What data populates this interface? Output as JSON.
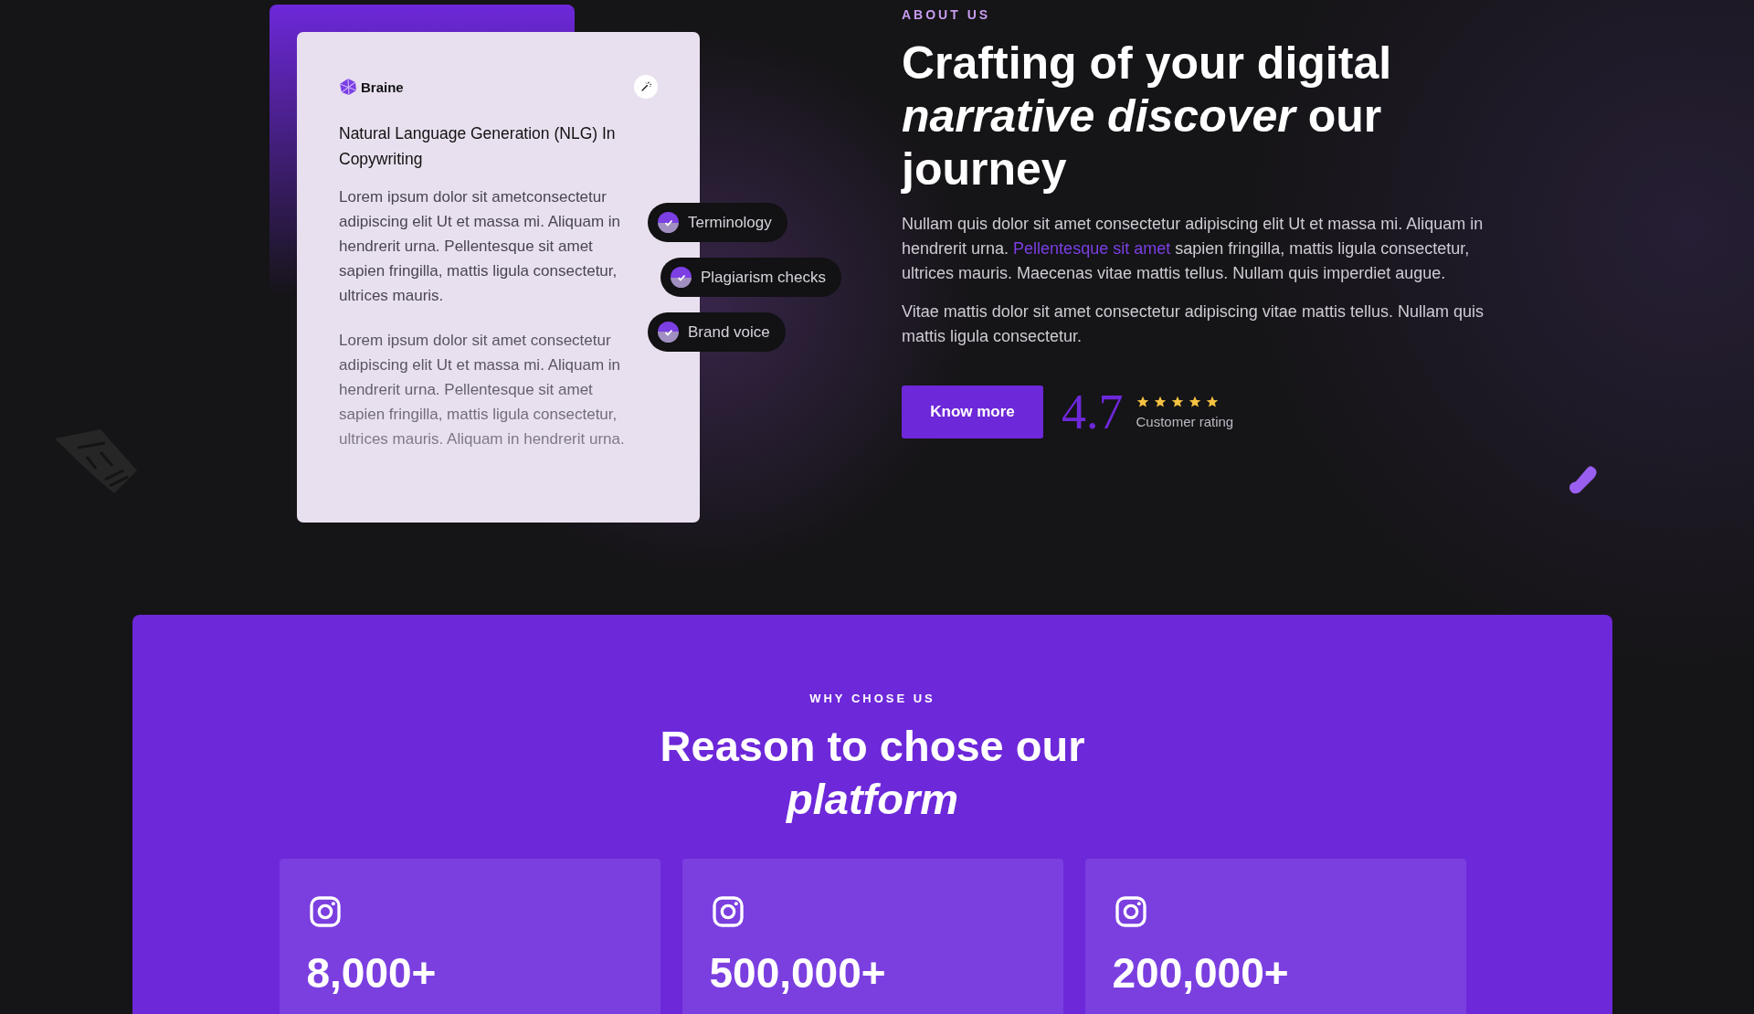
{
  "preview_card": {
    "brand": "Braine",
    "title": "Natural Language Generation (NLG) In Copywriting",
    "paragraphs": [
      "Lorem ipsum dolor sit ametconsectetur adipiscing elit Ut et massa mi. Aliquam in hendrerit urna. Pellentesque sit amet sapien fringilla, mattis ligula consectetur, ultrices mauris.",
      "Lorem ipsum dolor sit amet consectetur adipiscing elit Ut et massa mi. Aliquam in hendrerit urna. Pellentesque sit amet sapien fringilla, mattis ligula consectetur, ultrices mauris.  Aliquam in hendrerit urna."
    ],
    "chips": [
      {
        "label": "Terminology",
        "checked": true
      },
      {
        "label": "Plagiarism checks",
        "checked": true
      },
      {
        "label": "Brand voice",
        "checked": true
      }
    ]
  },
  "about": {
    "eyebrow": "ABOUT US",
    "heading": "Crafting of your digital *narrative discover* our journey",
    "paragraphs": [
      [
        {
          "kind": "text",
          "text": "Nullam quis dolor sit amet consectetur adipiscing elit Ut et massa mi. Aliquam in hendrerit urna. "
        },
        {
          "kind": "link",
          "text": "Pellentesque sit amet"
        },
        {
          "kind": "text",
          "text": " sapien fringilla, mattis ligula consectetur, ultrices mauris. Maecenas vitae mattis tellus. Nullam quis imperdiet augue."
        }
      ],
      [
        {
          "kind": "text",
          "text": "Vitae mattis dolor sit amet consectetur adipiscing vitae mattis tellus. Nullam quis mattis ligula consectetur."
        }
      ]
    ],
    "button": "Know more",
    "rating": {
      "score": "4.7",
      "stars": 5,
      "label": "Customer rating"
    }
  },
  "why": {
    "eyebrow": "WHY CHOSE US",
    "heading": "Reason to chose our *platform*",
    "stats": [
      {
        "value": "8,000+"
      },
      {
        "value": "500,000+"
      },
      {
        "value": "200,000+"
      }
    ]
  }
}
